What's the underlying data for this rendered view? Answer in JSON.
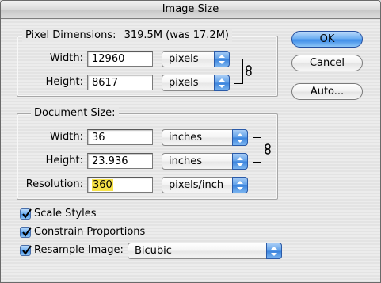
{
  "window": {
    "title": "Image Size"
  },
  "pixel_dimensions": {
    "legend": "Pixel Dimensions:",
    "size_text": "319.5M (was 17.2M)",
    "width": {
      "label": "Width:",
      "value": "12960",
      "unit": "pixels"
    },
    "height": {
      "label": "Height:",
      "value": "8617",
      "unit": "pixels"
    }
  },
  "document_size": {
    "legend": "Document Size:",
    "width": {
      "label": "Width:",
      "value": "36",
      "unit": "inches"
    },
    "height": {
      "label": "Height:",
      "value": "23.936",
      "unit": "inches"
    },
    "resolution": {
      "label": "Resolution:",
      "value": "360",
      "unit": "pixels/inch"
    }
  },
  "options": {
    "scale_styles": {
      "label": "Scale Styles",
      "checked": true
    },
    "constrain_proportions": {
      "label": "Constrain Proportions",
      "checked": true
    },
    "resample_image": {
      "label": "Resample Image:",
      "checked": true,
      "method": "Bicubic"
    }
  },
  "buttons": {
    "ok": "OK",
    "cancel": "Cancel",
    "auto": "Auto..."
  },
  "colors": {
    "accent": "#3d8ce8",
    "highlight": "#f7e34a"
  },
  "icons": {
    "link": "chain-link-icon",
    "popup": "updown-arrows-icon",
    "check": "checkmark-icon"
  }
}
